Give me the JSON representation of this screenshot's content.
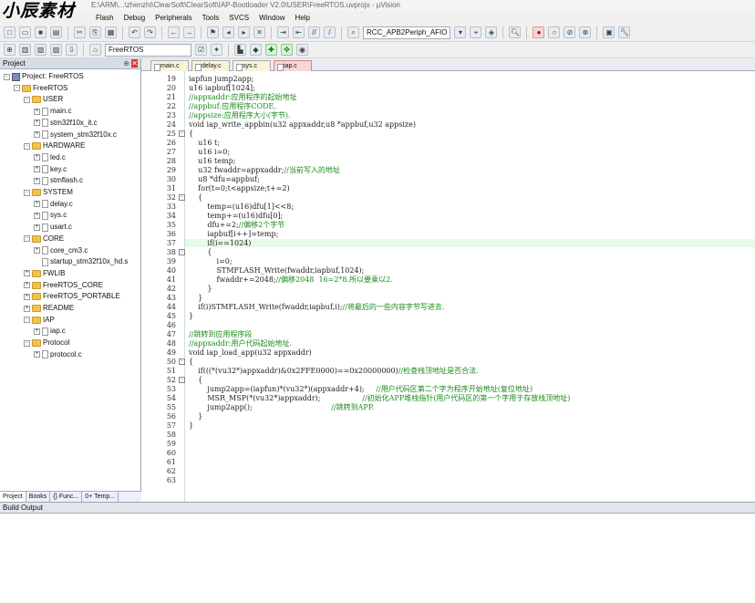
{
  "window": {
    "title": "E:\\ARM\\...\\zhenzhi\\ClearSoft\\ClearSoft\\IAP-Bootloader V2.0\\USER\\FreeRTOS.uvprojx - µVision",
    "watermark": "小辰素材"
  },
  "menu": [
    "Flash",
    "Debug",
    "Peripherals",
    "Tools",
    "SVCS",
    "Window",
    "Help"
  ],
  "toolbar": {
    "target_combo": "RCC_APB2Periph_AFIO",
    "project_combo": "FreeRTOS"
  },
  "project_panel": {
    "title": "Project",
    "tree": [
      {
        "label": "Project: FreeRTOS",
        "depth": 0,
        "kind": "project",
        "toggle": "-"
      },
      {
        "label": "FreeRTOS",
        "depth": 1,
        "kind": "folder",
        "toggle": "-"
      },
      {
        "label": "USER",
        "depth": 2,
        "kind": "folder",
        "toggle": "-"
      },
      {
        "label": "main.c",
        "depth": 3,
        "kind": "file",
        "toggle": "+"
      },
      {
        "label": "stm32f10x_it.c",
        "depth": 3,
        "kind": "file",
        "toggle": "+"
      },
      {
        "label": "system_stm32f10x.c",
        "depth": 3,
        "kind": "file",
        "toggle": "+"
      },
      {
        "label": "HARDWARE",
        "depth": 2,
        "kind": "folder",
        "toggle": "-"
      },
      {
        "label": "led.c",
        "depth": 3,
        "kind": "file",
        "toggle": "+"
      },
      {
        "label": "key.c",
        "depth": 3,
        "kind": "file",
        "toggle": "+"
      },
      {
        "label": "stmflash.c",
        "depth": 3,
        "kind": "file",
        "toggle": "+"
      },
      {
        "label": "SYSTEM",
        "depth": 2,
        "kind": "folder",
        "toggle": "-"
      },
      {
        "label": "delay.c",
        "depth": 3,
        "kind": "file",
        "toggle": "+"
      },
      {
        "label": "sys.c",
        "depth": 3,
        "kind": "file",
        "toggle": "+"
      },
      {
        "label": "usart.c",
        "depth": 3,
        "kind": "file",
        "toggle": "+"
      },
      {
        "label": "CORE",
        "depth": 2,
        "kind": "folder",
        "toggle": "-"
      },
      {
        "label": "core_cm3.c",
        "depth": 3,
        "kind": "file",
        "toggle": "+"
      },
      {
        "label": "startup_stm32f10x_hd.s",
        "depth": 3,
        "kind": "file",
        "toggle": ""
      },
      {
        "label": "FWLIB",
        "depth": 2,
        "kind": "folder",
        "toggle": "+"
      },
      {
        "label": "FreeRTOS_CORE",
        "depth": 2,
        "kind": "folder",
        "toggle": "+"
      },
      {
        "label": "FreeRTOS_PORTABLE",
        "depth": 2,
        "kind": "folder",
        "toggle": "+"
      },
      {
        "label": "README",
        "depth": 2,
        "kind": "folder",
        "toggle": "+"
      },
      {
        "label": "IAP",
        "depth": 2,
        "kind": "folder",
        "toggle": "-"
      },
      {
        "label": "iap.c",
        "depth": 3,
        "kind": "file",
        "toggle": "+"
      },
      {
        "label": "Protocol",
        "depth": 2,
        "kind": "folder",
        "toggle": "-"
      },
      {
        "label": "protocol.c",
        "depth": 3,
        "kind": "file",
        "toggle": "+"
      }
    ],
    "tabs": [
      "Project",
      "Books",
      "{} Func...",
      "0+ Temp..."
    ]
  },
  "editor": {
    "tabs": [
      "main.c",
      "delay.c",
      "sys.c",
      "iap.c"
    ],
    "active_tab_index": 3,
    "highlight_line": 37,
    "lines": [
      {
        "n": 19,
        "fold": "",
        "code": "iapfun jump2app;",
        "comment": ""
      },
      {
        "n": 20,
        "fold": "",
        "code": "u16 iapbuf[1024];",
        "comment": ""
      },
      {
        "n": 21,
        "fold": "",
        "code": "",
        "comment": "//appxaddr:应用程序的起始地址"
      },
      {
        "n": 22,
        "fold": "",
        "code": "",
        "comment": "//appbuf:应用程序CODE."
      },
      {
        "n": 23,
        "fold": "",
        "code": "",
        "comment": "//appsize:应用程序大小(字节)."
      },
      {
        "n": 24,
        "fold": "",
        "code": "void iap_write_appbin(u32 appxaddr,u8 *appbuf,u32 appsize)",
        "comment": ""
      },
      {
        "n": 25,
        "fold": "-",
        "code": "{",
        "comment": ""
      },
      {
        "n": 26,
        "fold": "",
        "code": "    u16 t;",
        "comment": ""
      },
      {
        "n": 27,
        "fold": "",
        "code": "    u16 i=0;",
        "comment": ""
      },
      {
        "n": 28,
        "fold": "",
        "code": "    u16 temp;",
        "comment": ""
      },
      {
        "n": 29,
        "fold": "",
        "code": "    u32 fwaddr=appxaddr;",
        "comment": "//当前写入的地址"
      },
      {
        "n": 30,
        "fold": "",
        "code": "    u8 *dfu=appbuf;",
        "comment": ""
      },
      {
        "n": 31,
        "fold": "",
        "code": "    for(t=0;t<appsize;t+=2)",
        "comment": ""
      },
      {
        "n": 32,
        "fold": "-",
        "code": "    {",
        "comment": ""
      },
      {
        "n": 33,
        "fold": "",
        "code": "        temp=(u16)dfu[1]<<8;",
        "comment": ""
      },
      {
        "n": 34,
        "fold": "",
        "code": "        temp+=(u16)dfu[0];",
        "comment": ""
      },
      {
        "n": 35,
        "fold": "",
        "code": "        dfu+=2;",
        "comment": "//偏移2个字节"
      },
      {
        "n": 36,
        "fold": "",
        "code": "        iapbuf[i++]=temp;",
        "comment": ""
      },
      {
        "n": 37,
        "fold": "",
        "code": "        if(i==1024)",
        "comment": ""
      },
      {
        "n": 38,
        "fold": "-",
        "code": "        {",
        "comment": ""
      },
      {
        "n": 39,
        "fold": "",
        "code": "            i=0;",
        "comment": ""
      },
      {
        "n": 40,
        "fold": "",
        "code": "            STMFLASH_Write(fwaddr,iapbuf,1024);",
        "comment": ""
      },
      {
        "n": 41,
        "fold": "",
        "code": "            fwaddr+=2048;",
        "comment": "//偏移2048  16=2*8.所以要乘以2."
      },
      {
        "n": 42,
        "fold": "",
        "code": "        }",
        "comment": ""
      },
      {
        "n": 43,
        "fold": "",
        "code": "    }",
        "comment": ""
      },
      {
        "n": 44,
        "fold": "",
        "code": "    if(i)STMFLASH_Write(fwaddr,iapbuf,i);",
        "comment": "//将最后的一些内容字节写进去."
      },
      {
        "n": 45,
        "fold": "",
        "code": "}",
        "comment": ""
      },
      {
        "n": 46,
        "fold": "",
        "code": "",
        "comment": ""
      },
      {
        "n": 47,
        "fold": "",
        "code": "",
        "comment": "//跳转到应用程序段"
      },
      {
        "n": 48,
        "fold": "",
        "code": "",
        "comment": "//appxaddr:用户代码起始地址."
      },
      {
        "n": 49,
        "fold": "",
        "code": "void iap_load_app(u32 appxaddr)",
        "comment": ""
      },
      {
        "n": 50,
        "fold": "-",
        "code": "{",
        "comment": ""
      },
      {
        "n": 51,
        "fold": "",
        "code": "    if(((*(vu32*)appxaddr)&0x2FFE0000)==0x20000000)",
        "comment": "//检查栈顶地址是否合法."
      },
      {
        "n": 52,
        "fold": "-",
        "code": "    {",
        "comment": ""
      },
      {
        "n": 53,
        "fold": "",
        "code": "        jump2app=(iapfun)*(vu32*)(appxaddr+4);",
        "comment": "     //用户代码区第二个字为程序开始地址(复位地址)"
      },
      {
        "n": 54,
        "fold": "",
        "code": "        MSR_MSP(*(vu32*)appxaddr);",
        "comment": "                  //初始化APP堆栈指针(用户代码区的第一个字用于存放栈顶地址)"
      },
      {
        "n": 55,
        "fold": "",
        "code": "        jump2app();",
        "comment": "                                  //跳转到APP."
      },
      {
        "n": 56,
        "fold": "",
        "code": "    }",
        "comment": ""
      },
      {
        "n": 57,
        "fold": "",
        "code": "}",
        "comment": ""
      },
      {
        "n": 58,
        "fold": "",
        "code": "",
        "comment": ""
      },
      {
        "n": 59,
        "fold": "",
        "code": "",
        "comment": ""
      },
      {
        "n": 60,
        "fold": "",
        "code": "",
        "comment": ""
      },
      {
        "n": 61,
        "fold": "",
        "code": "",
        "comment": ""
      },
      {
        "n": 62,
        "fold": "",
        "code": "",
        "comment": ""
      },
      {
        "n": 63,
        "fold": "",
        "code": "",
        "comment": ""
      }
    ]
  },
  "build_output": {
    "title": "Build Output"
  },
  "colors": {
    "comment": "#1a8a1a",
    "highlight": "#e6fae6",
    "active_tab": "#f9d7d7"
  }
}
